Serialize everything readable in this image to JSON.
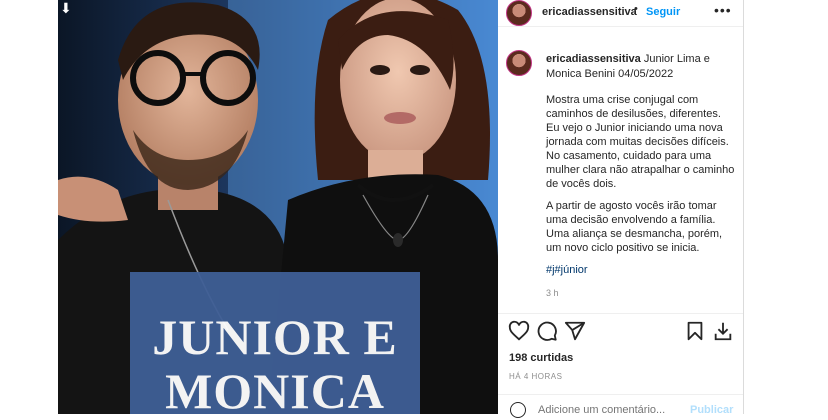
{
  "post": {
    "image_caption_line1": "JUNIOR E",
    "image_caption_line2": "MONICA"
  },
  "header": {
    "username": "ericadiassensitiva",
    "separator": "•",
    "follow_label": "Seguir",
    "more_label": "•••"
  },
  "caption": {
    "username": "ericadiassensitiva",
    "title": "Junior Lima e Monica Benini 04/05/2022",
    "paragraph1": "Mostra uma crise conjugal com caminhos de desilusões, diferentes. Eu vejo o Junior iniciando uma nova jornada com muitas decisões difíceis. No casamento, cuidado para uma mulher clara não atrapalhar o caminho de vocês dois.",
    "paragraph2": "A partir de agosto vocês irão tomar uma decisão envolvendo a família. Uma aliança se desmancha, porém, um novo ciclo positivo se inicia.",
    "hashtags": "#j#júnior",
    "time": "3 h"
  },
  "actions": {
    "likes": "198 curtidas",
    "posted_ago": "HÁ 4 HORAS"
  },
  "comment": {
    "placeholder": "Adicione um comentário...",
    "publish_label": "Publicar"
  }
}
